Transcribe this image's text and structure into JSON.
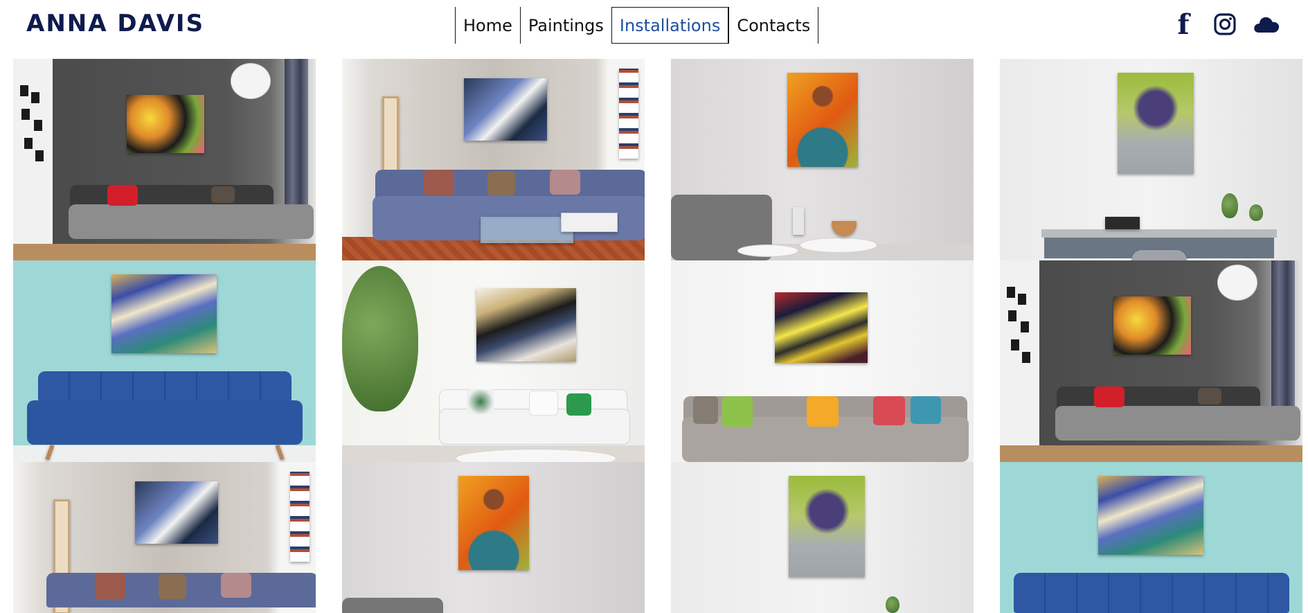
{
  "site": {
    "brand": "ANNA DAVIS"
  },
  "nav": {
    "items": [
      {
        "label": "Home",
        "active": false
      },
      {
        "label": "Paintings",
        "active": false
      },
      {
        "label": "Installations",
        "active": true
      },
      {
        "label": "Contacts",
        "active": false
      }
    ]
  },
  "social": {
    "icons": [
      "facebook-icon",
      "instagram-icon",
      "cloud-icon"
    ]
  },
  "colors": {
    "brand": "#0e1b4d",
    "active_nav": "#1f4fa0",
    "text": "#121212"
  },
  "gallery": {
    "tiles": [
      {
        "scene": "dark-wall-gray-sofa",
        "painting": "abstract-yellow-red-black"
      },
      {
        "scene": "blue-sofa-room",
        "painting": "abstract-blue-white"
      },
      {
        "scene": "gray-wall-side-tables",
        "painting": "girl-in-teal-dress-orange"
      },
      {
        "scene": "white-wall-desk",
        "painting": "purple-flowers-green"
      },
      {
        "scene": "teal-wall-blue-sofa",
        "painting": "abstract-blue-gold-waves"
      },
      {
        "scene": "white-sofa-plant",
        "painting": "abstract-gold-black-white"
      },
      {
        "scene": "gray-sofa-colorful-pillows",
        "painting": "abstract-yellow-red-black-strokes"
      },
      {
        "scene": "dark-wall-gray-sofa",
        "painting": "abstract-yellow-red-black"
      },
      {
        "scene": "blue-sofa-room",
        "painting": "abstract-blue-white"
      },
      {
        "scene": "gray-wall-side-tables",
        "painting": "girl-in-teal-dress-orange"
      },
      {
        "scene": "white-wall-desk",
        "painting": "purple-flowers-green"
      },
      {
        "scene": "teal-wall-blue-sofa",
        "painting": "abstract-blue-gold-waves"
      }
    ]
  }
}
